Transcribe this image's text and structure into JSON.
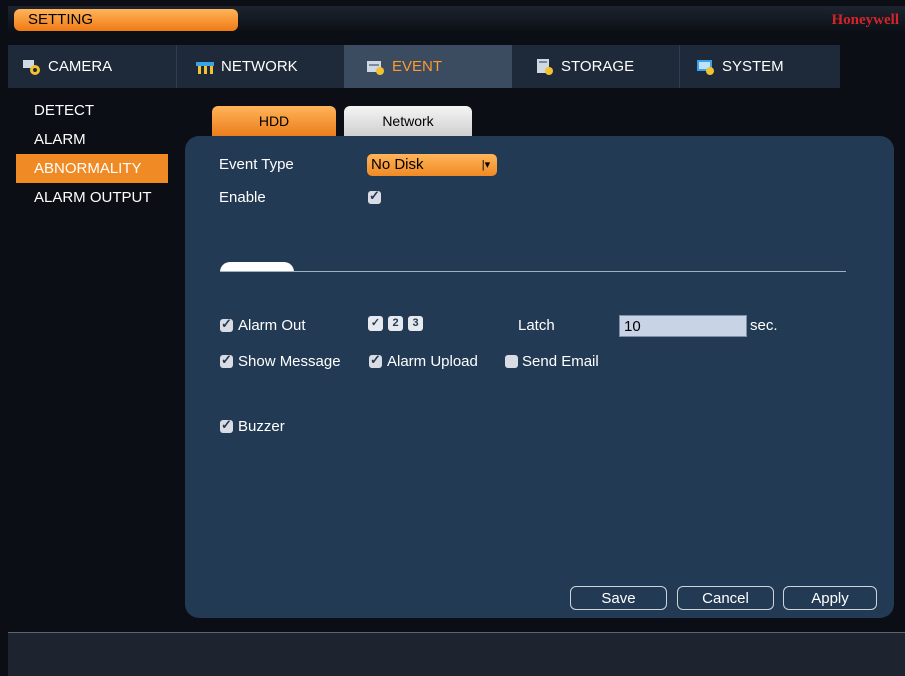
{
  "titlebar": {
    "setting_label": "SETTING",
    "brand": "Honeywell"
  },
  "tabs": [
    {
      "label": "CAMERA",
      "icon": "camera-gear-icon"
    },
    {
      "label": "NETWORK",
      "icon": "network-icon"
    },
    {
      "label": "EVENT",
      "icon": "event-icon",
      "active": true
    },
    {
      "label": "STORAGE",
      "icon": "storage-icon"
    },
    {
      "label": "SYSTEM",
      "icon": "system-icon"
    }
  ],
  "leftnav": [
    {
      "label": "DETECT"
    },
    {
      "label": "ALARM"
    },
    {
      "label": "ABNORMALITY",
      "active": true
    },
    {
      "label": "ALARM OUTPUT"
    }
  ],
  "subtabs": {
    "hdd": "HDD",
    "network": "Network"
  },
  "form": {
    "event_type_label": "Event Type",
    "event_type_value": "No Disk",
    "enable_label": "Enable",
    "alarm_out_label": "Alarm Out",
    "channels": [
      "1",
      "2",
      "3"
    ],
    "latch_label": "Latch",
    "latch_value": "10",
    "latch_unit": "sec.",
    "show_message_label": "Show Message",
    "alarm_upload_label": "Alarm Upload",
    "send_email_label": "Send Email",
    "buzzer_label": "Buzzer"
  },
  "buttons": {
    "save": "Save",
    "cancel": "Cancel",
    "apply": "Apply"
  },
  "colors": {
    "accent": "#f08a24",
    "panel": "#233a55",
    "brand": "#d4242a"
  }
}
